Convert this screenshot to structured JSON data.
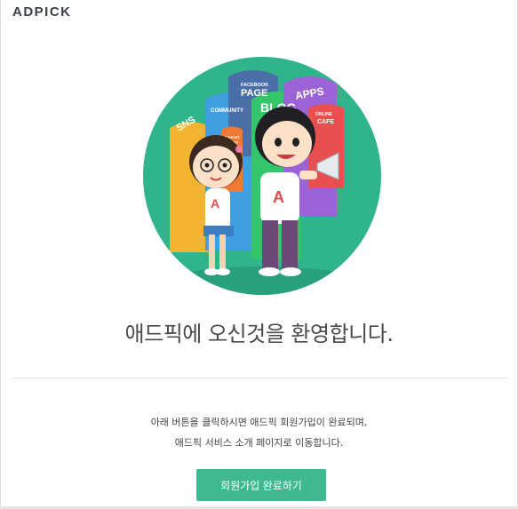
{
  "header": {
    "logo_text": "ADPICK"
  },
  "hero": {
    "bubble_labels": [
      "SNS",
      "COMMUNITY",
      "FACEBOOK",
      "PAGE",
      "BLOG",
      "APPS",
      "ONLINE",
      "CAFE",
      "KAKAO",
      "STORY"
    ],
    "shirt_letter": "A",
    "colors": {
      "circle": "#2fb48b",
      "circle_inner": "#45c69b"
    }
  },
  "main": {
    "welcome_text": "애드픽에 오신것을 환영합니다.",
    "description_line1": "아래 버튼을 클릭하시면 애드픽 회원가입이 완료되며,",
    "description_line2": "애드픽 서비스 소개 페이지로 이동합니다.",
    "complete_button_label": "회원가입 완료하기"
  },
  "colors": {
    "accent": "#3fba8f",
    "text": "#4a4a4a"
  }
}
